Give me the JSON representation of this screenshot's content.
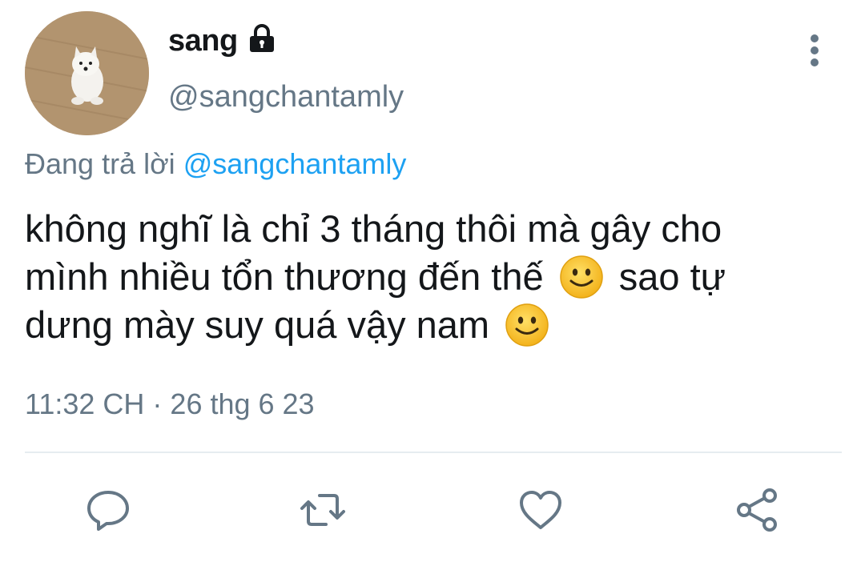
{
  "author": {
    "display_name": "sang",
    "handle": "@sangchantamly",
    "verified_icon": "lock-icon"
  },
  "reply_to": {
    "prefix": "Đang trả lời",
    "mention": "@sangchantamly"
  },
  "tweet": {
    "line1": "không nghĩ là chỉ 3 tháng thôi mà gây cho",
    "line2_a": "mình nhiều tổn thương đến thế",
    "line2_b": "sao tự",
    "line3": "dưng mày suy quá vậy nam",
    "emoji": "slightly-smiling-face"
  },
  "meta": {
    "time": "11:32 CH",
    "separator": " · ",
    "date": "26 thg 6 23"
  },
  "actions": [
    "reply-icon",
    "retweet-icon",
    "like-icon",
    "share-icon"
  ],
  "colors": {
    "secondary_text": "#657786",
    "link": "#1da1f2",
    "text": "#14171a",
    "divider": "#e6ecf0"
  }
}
